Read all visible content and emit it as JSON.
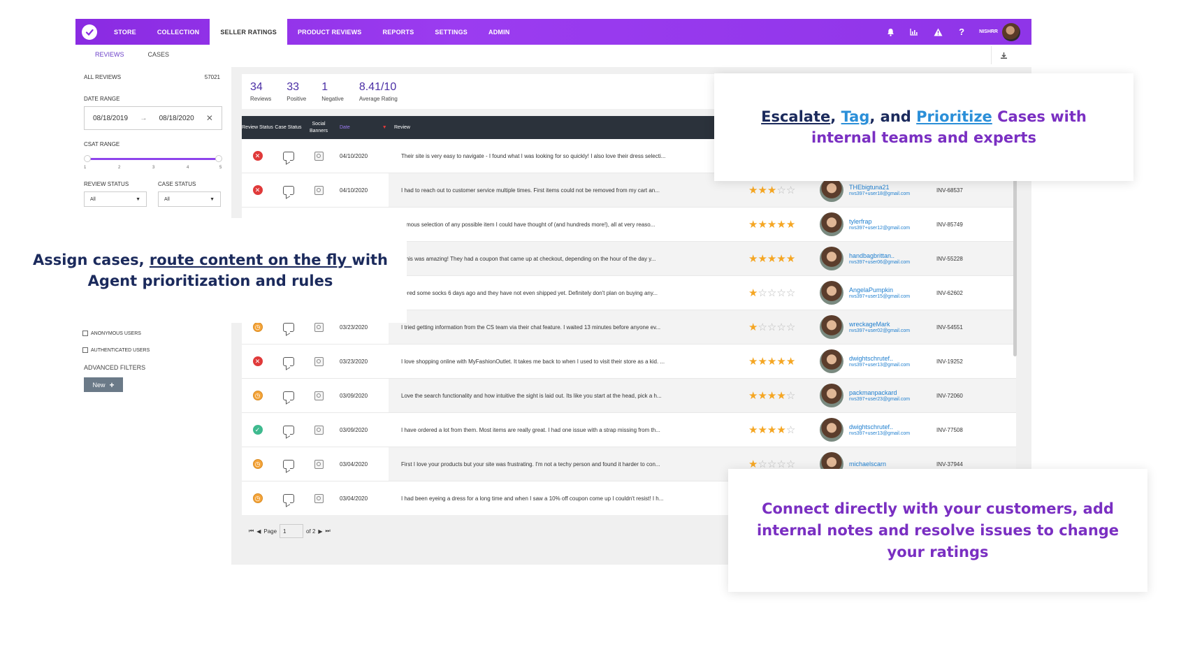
{
  "nav": {
    "items": [
      "STORE",
      "COLLECTION",
      "SELLER RATINGS",
      "PRODUCT REVIEWS",
      "REPORTS",
      "SETTINGS",
      "ADMIN"
    ],
    "active": "SELLER RATINGS",
    "user_name": "NISHRR"
  },
  "subtabs": [
    "REVIEWS",
    "CASES"
  ],
  "sidebar": {
    "all_reviews_label": "ALL REVIEWS",
    "all_reviews_count": "57021",
    "date_range_label": "DATE RANGE",
    "date_from": "08/18/2019",
    "date_to": "08/18/2020",
    "csat_label": "CSAT RANGE",
    "csat_ticks": [
      "1",
      "2",
      "3",
      "4",
      "5"
    ],
    "csat_range": [
      1,
      5
    ],
    "review_status_label": "REVIEW STATUS",
    "review_status_value": "All",
    "case_status_label": "CASE STATUS",
    "case_status_value": "All",
    "anonymous_label": "ANONYMOUS USERS",
    "authenticated_label": "AUTHENTICATED USERS",
    "advanced_label": "ADVANCED FILTERS",
    "new_label": "New"
  },
  "stats": [
    {
      "value": "34",
      "label": "Reviews"
    },
    {
      "value": "33",
      "label": "Positive"
    },
    {
      "value": "1",
      "label": "Negative"
    },
    {
      "value": "8.41/10",
      "label": "Average Rating"
    }
  ],
  "table": {
    "headers": {
      "review_status": "Review Status",
      "case_status": "Case Status",
      "social": "Social Banners",
      "date": "Date",
      "review": "Review"
    },
    "rows": [
      {
        "status": "red",
        "date": "04/10/2020",
        "review": "Their site is very easy to navigate - I found what I was looking for so quickly! I also love their dress selecti...",
        "stars": null,
        "user": "",
        "email": "",
        "inv": ""
      },
      {
        "status": "red",
        "date": "04/10/2020",
        "review": "I had to reach out to customer service multiple times. First items could not be removed from my cart an...",
        "stars": 3,
        "user": "THEbigtuna21",
        "email": "nvs397+user18@gmail.com",
        "inv": "INV-68537"
      },
      {
        "status": "none",
        "date": "",
        "review": "ormous selection of any possible item I could have thought of (and hundreds more!), all at very reaso...",
        "stars": 5,
        "user": "tylerfrap",
        "email": "nvs397+user12@gmail.com",
        "inv": "INV-85749"
      },
      {
        "status": "none",
        "date": "",
        "review": ", this was amazing! They had a coupon that came up at checkout, depending on the hour of the day y...",
        "stars": 5,
        "user": "handbagbrittan..",
        "email": "nvs397+user06@gmail.com",
        "inv": "INV-55228"
      },
      {
        "status": "none",
        "date": "",
        "review": "dered some socks 6 days ago and they have not even shipped yet. Definitely don't plan on buying any...",
        "stars": 1,
        "user": "AngelaPumpkin",
        "email": "nvs397+user15@gmail.com",
        "inv": "INV-62602"
      },
      {
        "status": "orange",
        "date": "03/23/2020",
        "review": "I tried getting information from the CS team via their chat feature. I waited 13 minutes before anyone ev...",
        "stars": 1,
        "user": "wreckageMark",
        "email": "nvs397+user02@gmail.com",
        "inv": "INV-54551"
      },
      {
        "status": "red",
        "date": "03/23/2020",
        "review": "I love shopping online with MyFashionOutlet. It takes me back to when I used to visit their store as a kid. ...",
        "stars": 5,
        "user": "dwightschrutef..",
        "email": "nvs397+user13@gmail.com",
        "inv": "INV-19252"
      },
      {
        "status": "orange",
        "date": "03/09/2020",
        "review": "Love the search functionality and how intuitive the sight is laid out. Its like you start at the head, pick a h...",
        "stars": 4,
        "user": "packmanpackard",
        "email": "nvs397+user23@gmail.com",
        "inv": "INV-72060"
      },
      {
        "status": "green",
        "date": "03/09/2020",
        "review": "I have ordered a lot from them. Most items are really great. I had one issue with a strap missing from th...",
        "stars": 4,
        "user": "dwightschrutef..",
        "email": "nvs397+user13@gmail.com",
        "inv": "INV-77508"
      },
      {
        "status": "orange",
        "date": "03/04/2020",
        "review": "First I love your products but your site was frustrating. I'm not a techy person and found it harder to con...",
        "stars": 1,
        "user": "michaelscarn",
        "email": "",
        "inv": "INV-37944"
      },
      {
        "status": "orange",
        "date": "03/04/2020",
        "review": "I had been eyeing a dress for a long time and when I saw a 10% off coupon come up I couldn't resist! I h...",
        "stars": null,
        "user": "",
        "email": "",
        "inv": ""
      }
    ]
  },
  "pager": {
    "page_label": "Page",
    "page": "1",
    "of": "of 2"
  },
  "callouts": {
    "top": {
      "escalate": "Escalate",
      "comma1": ", ",
      "tag": "Tag",
      "and": ", and ",
      "prioritize": "Prioritize",
      "rest": " Cases with internal teams and experts"
    },
    "left": {
      "prefix": "Assign cases, ",
      "link": "route content on the fly ",
      "rest": "with Agent prioritization and rules"
    },
    "bottom": "Connect directly with your customers, add internal notes and resolve issues to change your ratings"
  },
  "colors": {
    "accent": "#8a2be2",
    "header_dark": "#2b323b",
    "star": "#f5a623",
    "link": "#1f7fcf"
  }
}
